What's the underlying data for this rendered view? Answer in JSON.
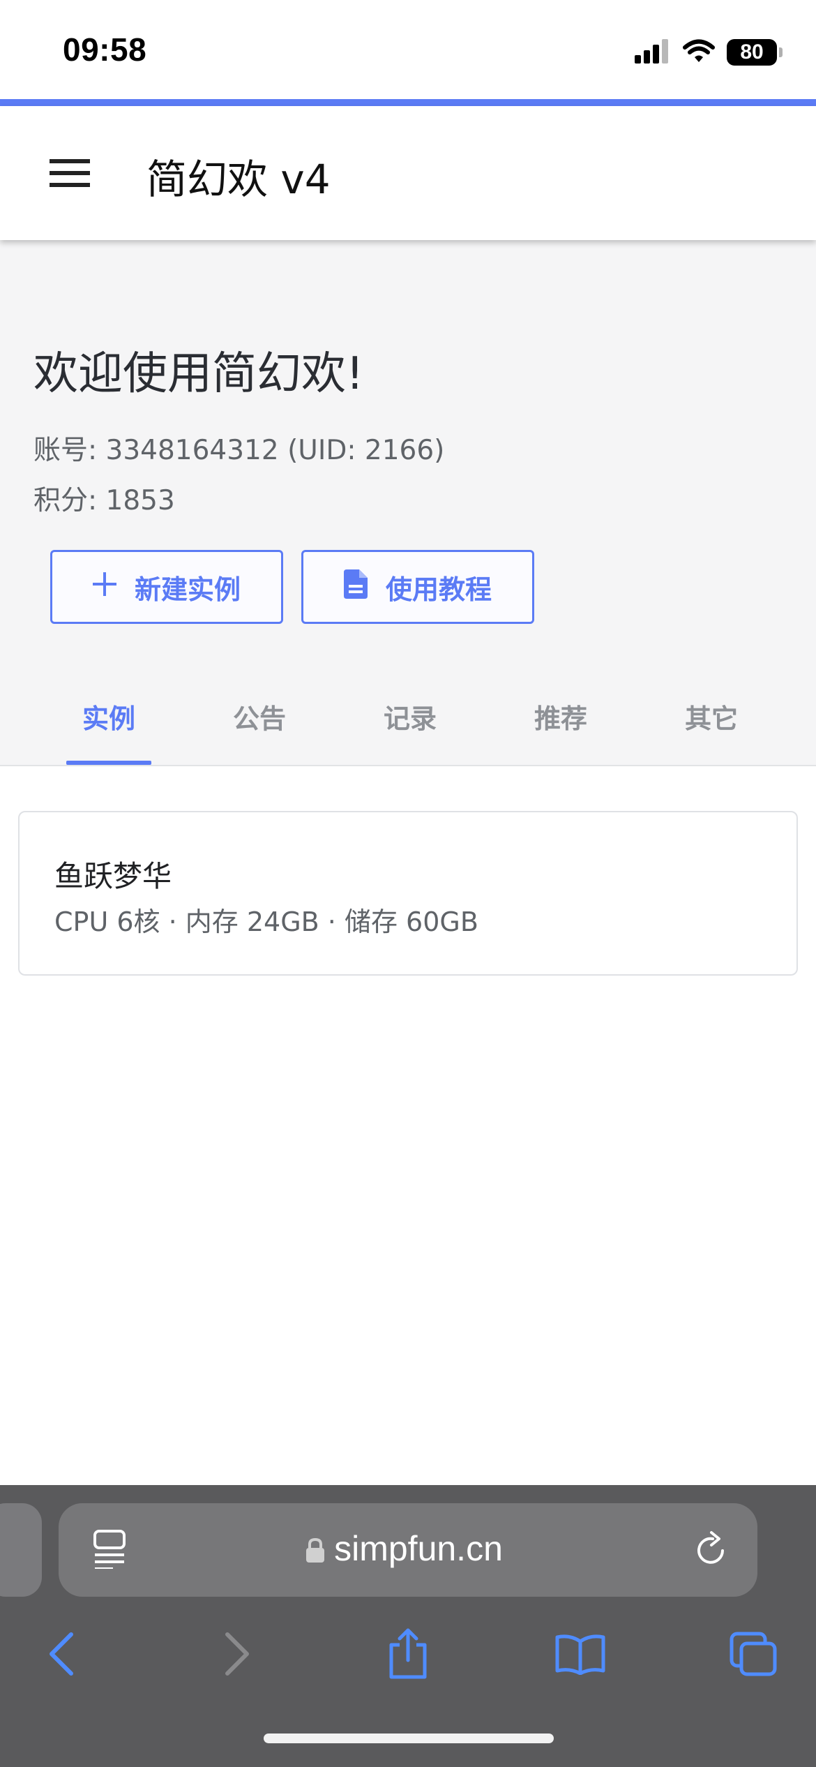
{
  "status_bar": {
    "time": "09:58",
    "battery": "80",
    "icons": [
      "signal-icon",
      "wifi-icon",
      "battery-icon"
    ]
  },
  "colors": {
    "accent": "#5b7bf5",
    "page_bg": "#f5f5f6",
    "safari_bar": "#5a5a5c"
  },
  "appbar": {
    "title": "简幻欢 v4",
    "menu_icon": "hamburger-menu-icon"
  },
  "welcome": {
    "heading": "欢迎使用简幻欢!",
    "account": "账号: 3348164312 (UID: 2166)",
    "points": "积分: 1853"
  },
  "actions": {
    "new_instance": "新建实例",
    "tutorial": "使用教程"
  },
  "tabs": [
    {
      "label": "实例",
      "active": true
    },
    {
      "label": "公告",
      "active": false
    },
    {
      "label": "记录",
      "active": false
    },
    {
      "label": "推荐",
      "active": false
    },
    {
      "label": "其它",
      "active": false
    }
  ],
  "instances": [
    {
      "name": "鱼跃梦华",
      "specs": "CPU 6核 · 内存 24GB · 储存 60GB"
    }
  ],
  "browser": {
    "url": "simpfun.cn",
    "toolbar_icons": [
      "back-icon",
      "forward-icon",
      "share-icon",
      "bookmarks-icon",
      "tabs-icon"
    ]
  }
}
